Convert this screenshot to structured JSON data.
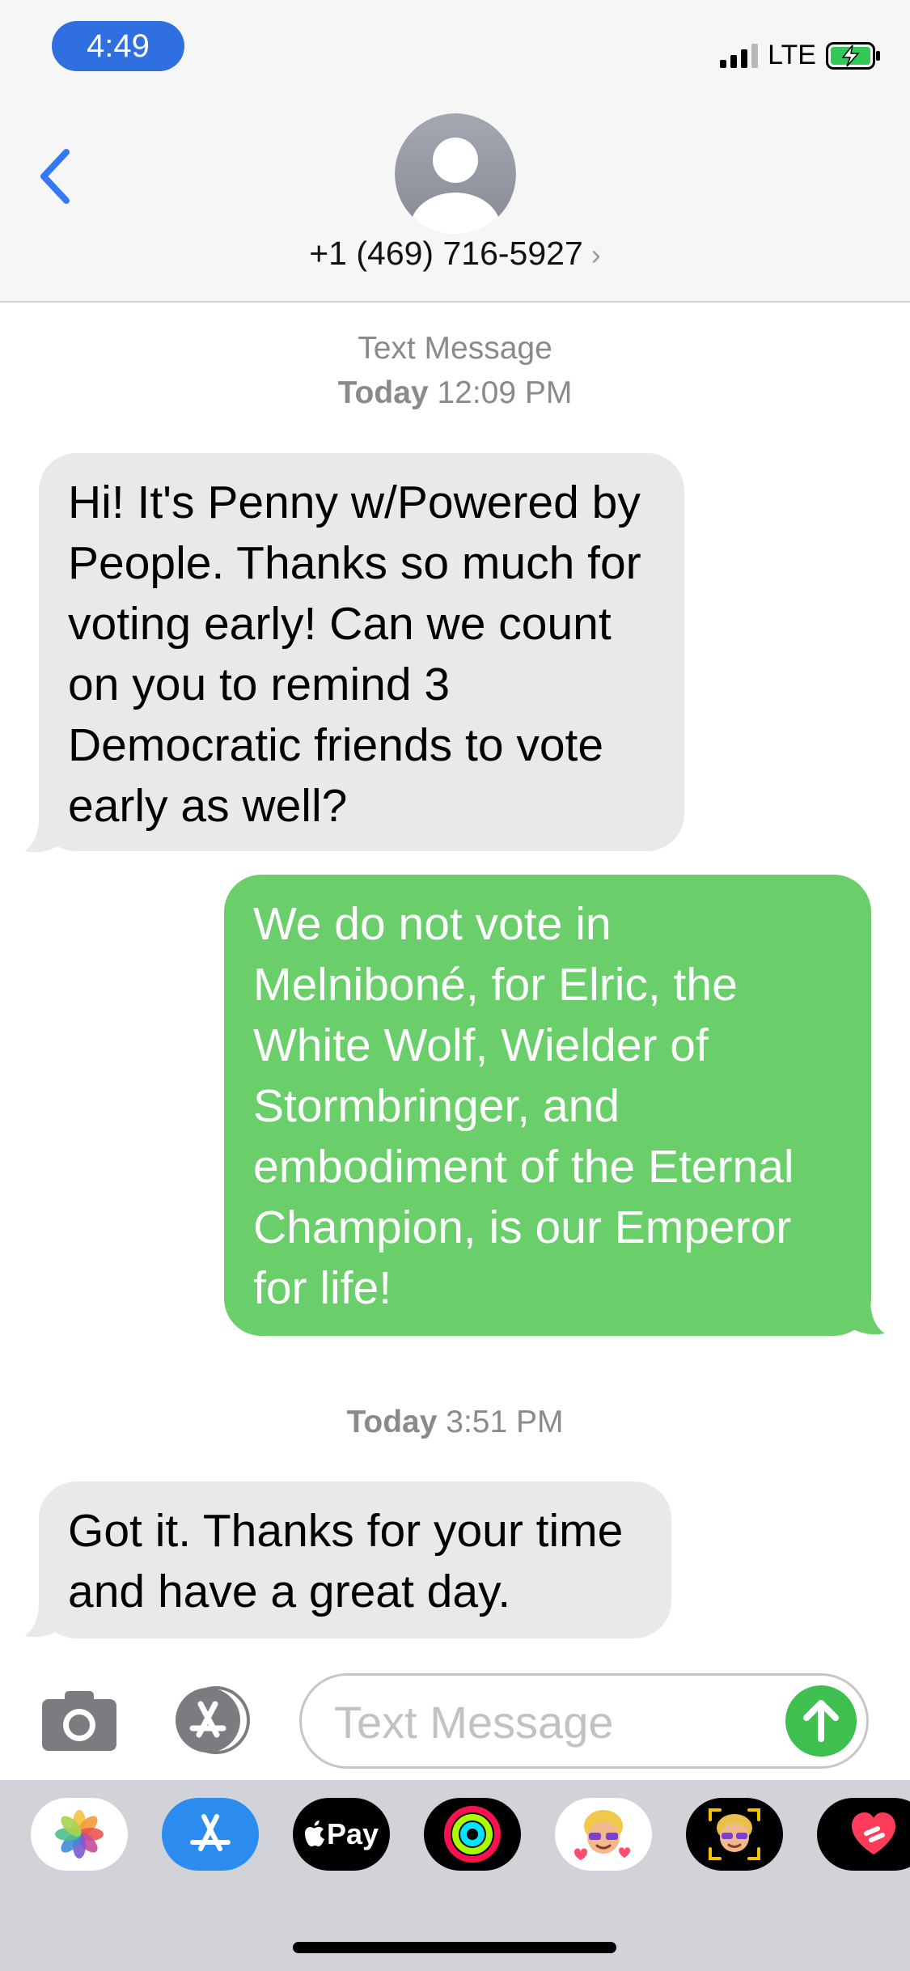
{
  "status_bar": {
    "time": "4:49",
    "network": "LTE"
  },
  "header": {
    "contact": "+1 (469) 716-5927",
    "contact_chevron": "›"
  },
  "thread": {
    "service_label": "Text Message",
    "stamp1_day": "Today",
    "stamp1_time": "12:09 PM",
    "stamp2_day": "Today",
    "stamp2_time": "3:51 PM",
    "messages": [
      {
        "direction": "incoming",
        "text": "Hi! It's Penny w/Powered by People. Thanks so much for voting early! Can we count on you to remind 3 Democratic friends to vote early as well?"
      },
      {
        "direction": "outgoing",
        "text": "We do not vote in Melniboné, for Elric, the White Wolf, Wielder of Stormbringer, and embodiment of the Eternal Champion, is our Emperor for life!"
      },
      {
        "direction": "incoming",
        "text": "Got it. Thanks for your time and have a great day."
      }
    ]
  },
  "compose": {
    "placeholder": "Text Message"
  },
  "app_drawer": {
    "items": [
      {
        "name": "photos-app",
        "icon": "photos-icon"
      },
      {
        "name": "app-store",
        "icon": "app-store-icon"
      },
      {
        "name": "apple-pay",
        "label": "Pay",
        "icon": "apple-logo-icon"
      },
      {
        "name": "activity",
        "icon": "activity-rings-icon"
      },
      {
        "name": "memoji-stickers",
        "icon": "memoji-icon"
      },
      {
        "name": "animoji",
        "icon": "animoji-icon"
      },
      {
        "name": "digital-touch",
        "icon": "digital-touch-heart-icon"
      }
    ]
  },
  "colors": {
    "time_pill": "#2f6fe0",
    "incoming_bubble": "#e9e9eb",
    "outgoing_bubble": "#6acf6a",
    "send_button": "#3fbf4d",
    "ios_blue": "#3478f6"
  }
}
